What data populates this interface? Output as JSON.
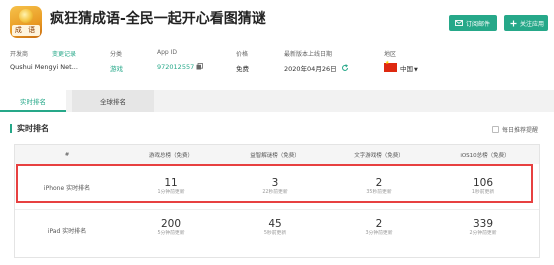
{
  "app": {
    "title": "疯狂猜成语-全民一起开心看图猜谜",
    "icon_text": "成 语"
  },
  "actions": {
    "subscribe_label": "订阅邮件",
    "follow_label": "关注应用"
  },
  "meta": {
    "developer_label": "开发商",
    "developer_value": "Qushui Mengyi Net...",
    "change_record_label": "变更记录",
    "category_label": "分类",
    "category_value": "游戏",
    "app_id_label": "App ID",
    "app_id_value": "972012557",
    "price_label": "价格",
    "price_value": "免费",
    "latest_update_label": "最新版本上线日期",
    "latest_update_value": "2020年04月26日",
    "region_label": "地区",
    "region_value": "中国"
  },
  "tabs": {
    "realtime": "实时排名",
    "global": "全球排名"
  },
  "section": {
    "title": "实时排名",
    "daily_remind": "每日推荐提醒"
  },
  "table": {
    "columns": [
      "#",
      "游戏总榜（免费）",
      "益智解谜榜（免费）",
      "文字游戏榜（免费）",
      "iOS10总榜（免费）"
    ],
    "rows": [
      {
        "label": "iPhone 实时排名",
        "cells": [
          {
            "rank": "11",
            "updated": "1分钟前更新"
          },
          {
            "rank": "3",
            "updated": "22秒前更新"
          },
          {
            "rank": "2",
            "updated": "35秒前更新"
          },
          {
            "rank": "106",
            "updated": "1秒前更新"
          }
        ]
      },
      {
        "label": "iPad 实时排名",
        "cells": [
          {
            "rank": "200",
            "updated": "5分钟前更新"
          },
          {
            "rank": "45",
            "updated": "5秒前更新"
          },
          {
            "rank": "2",
            "updated": "3分钟前更新"
          },
          {
            "rank": "339",
            "updated": "2分钟前更新"
          }
        ]
      }
    ]
  },
  "colors": {
    "accent": "#26a889",
    "highlight": "#e74040"
  },
  "icons": [
    "app-icon",
    "mail-icon",
    "plus-icon",
    "copy-icon",
    "refresh-icon",
    "china-flag-icon",
    "dropdown-arrow-icon",
    "checkbox-icon"
  ]
}
